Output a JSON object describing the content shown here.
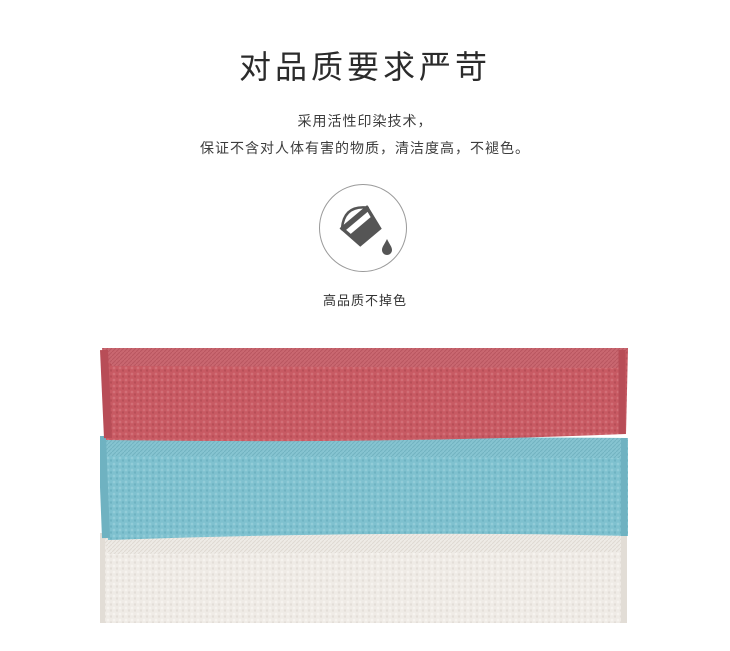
{
  "heading": {
    "title": "对品质要求严苛",
    "line1": "采用活性印染技术，",
    "line2": "保证不含对人体有害的物质，清洁度高，不褪色。"
  },
  "feature": {
    "icon": "paint-bucket-drop-icon",
    "caption": "高品质不掉色",
    "icon_color": "#555555"
  },
  "product_image": {
    "towel_colors": [
      "#c85a63",
      "#7fc1cf",
      "#efebe6"
    ]
  }
}
